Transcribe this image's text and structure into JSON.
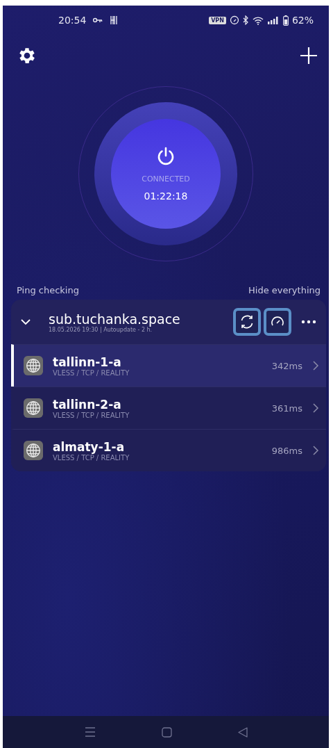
{
  "status_bar": {
    "time": "20:54",
    "vpn_badge": "VPN",
    "battery": "62%"
  },
  "connection": {
    "status": "CONNECTED",
    "timer": "01:22:18"
  },
  "list_header": {
    "left": "Ping checking",
    "right": "Hide everything"
  },
  "subscription": {
    "name": "sub.tuchanka.space",
    "subtitle": "18.05.2026 19:30 | Autoupdate - 2 h.",
    "expanded": true
  },
  "servers": [
    {
      "name": "tallinn-1-a",
      "protocol": "VLESS / TCP / REALITY",
      "ping": "342ms",
      "selected": true
    },
    {
      "name": "tallinn-2-a",
      "protocol": "VLESS / TCP / REALITY",
      "ping": "361ms",
      "selected": false
    },
    {
      "name": "almaty-1-a",
      "protocol": "VLESS / TCP / REALITY",
      "ping": "986ms",
      "selected": false
    }
  ]
}
